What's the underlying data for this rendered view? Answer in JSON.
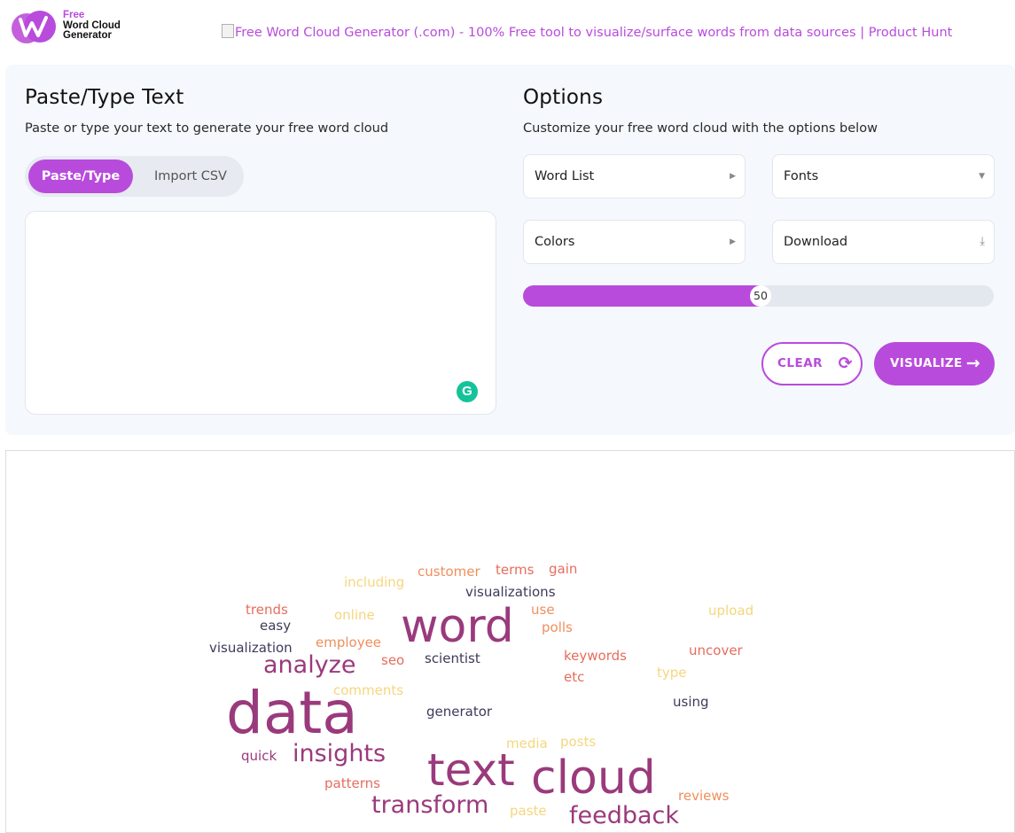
{
  "header": {
    "logo_free": "Free",
    "logo_line1": "Word Cloud",
    "logo_line2": "Generator",
    "product_hunt_alt": "Free Word Cloud Generator (.com) - 100% Free tool to visualize/surface words from data sources | Product Hunt"
  },
  "left": {
    "title": "Paste/Type Text",
    "subtitle": "Paste or type your text to generate your free word cloud",
    "tab_paste": "Paste/Type",
    "tab_import": "Import CSV",
    "textarea_value": ""
  },
  "right": {
    "title": "Options",
    "subtitle": "Customize your free word cloud with the options below",
    "word_list": "Word List",
    "fonts": "Fonts",
    "colors": "Colors",
    "download": "Download",
    "slider_value": "50",
    "slider_fraction": 0.5,
    "clear": "CLEAR",
    "visualize": "VISUALIZE"
  },
  "colors": {
    "accent": "#b84bdc",
    "panel_bg": "#f5f8fc"
  },
  "cloud": [
    {
      "text": "data",
      "color": "#9a3a7c",
      "size": 66
    },
    {
      "text": "word",
      "color": "#9a3a7c",
      "size": 52
    },
    {
      "text": "text",
      "color": "#9a3a7c",
      "size": 50
    },
    {
      "text": "cloud",
      "color": "#9a3a7c",
      "size": 52
    },
    {
      "text": "analyze",
      "color": "#9a3a7c",
      "size": 27
    },
    {
      "text": "insights",
      "color": "#9a3a7c",
      "size": 27
    },
    {
      "text": "transform",
      "color": "#9a3a7c",
      "size": 27
    },
    {
      "text": "feedback",
      "color": "#9a3a7c",
      "size": 27
    },
    {
      "text": "customer",
      "color": "#ef8f5d",
      "size": 15
    },
    {
      "text": "terms",
      "color": "#e56d5d",
      "size": 15
    },
    {
      "text": "gain",
      "color": "#e56d5d",
      "size": 15
    },
    {
      "text": "including",
      "color": "#f5d67e",
      "size": 15
    },
    {
      "text": "visualizations",
      "color": "#3d3b5a",
      "size": 15
    },
    {
      "text": "trends",
      "color": "#e56d5d",
      "size": 15
    },
    {
      "text": "online",
      "color": "#f5d67e",
      "size": 15
    },
    {
      "text": "use",
      "color": "#ef8f5d",
      "size": 15
    },
    {
      "text": "upload",
      "color": "#f5d67e",
      "size": 15
    },
    {
      "text": "easy",
      "color": "#3d3b5a",
      "size": 15
    },
    {
      "text": "polls",
      "color": "#ef8f5d",
      "size": 15
    },
    {
      "text": "employee",
      "color": "#ef8f5d",
      "size": 15
    },
    {
      "text": "visualization",
      "color": "#3d3b5a",
      "size": 15
    },
    {
      "text": "uncover",
      "color": "#e56d5d",
      "size": 15
    },
    {
      "text": "keywords",
      "color": "#e56d5d",
      "size": 15
    },
    {
      "text": "seo",
      "color": "#e56d5d",
      "size": 15
    },
    {
      "text": "scientist",
      "color": "#3d3b5a",
      "size": 15
    },
    {
      "text": "type",
      "color": "#f5d67e",
      "size": 15
    },
    {
      "text": "etc",
      "color": "#e56d5d",
      "size": 15
    },
    {
      "text": "comments",
      "color": "#f5d67e",
      "size": 15
    },
    {
      "text": "using",
      "color": "#3d3b5a",
      "size": 15
    },
    {
      "text": "generator",
      "color": "#3d3b5a",
      "size": 15
    },
    {
      "text": "media",
      "color": "#f5d67e",
      "size": 15
    },
    {
      "text": "posts",
      "color": "#f5d67e",
      "size": 15
    },
    {
      "text": "quick",
      "color": "#9a3a7c",
      "size": 15
    },
    {
      "text": "patterns",
      "color": "#e56d5d",
      "size": 15
    },
    {
      "text": "reviews",
      "color": "#ef8f5d",
      "size": 15
    },
    {
      "text": "paste",
      "color": "#f5d67e",
      "size": 15
    }
  ]
}
